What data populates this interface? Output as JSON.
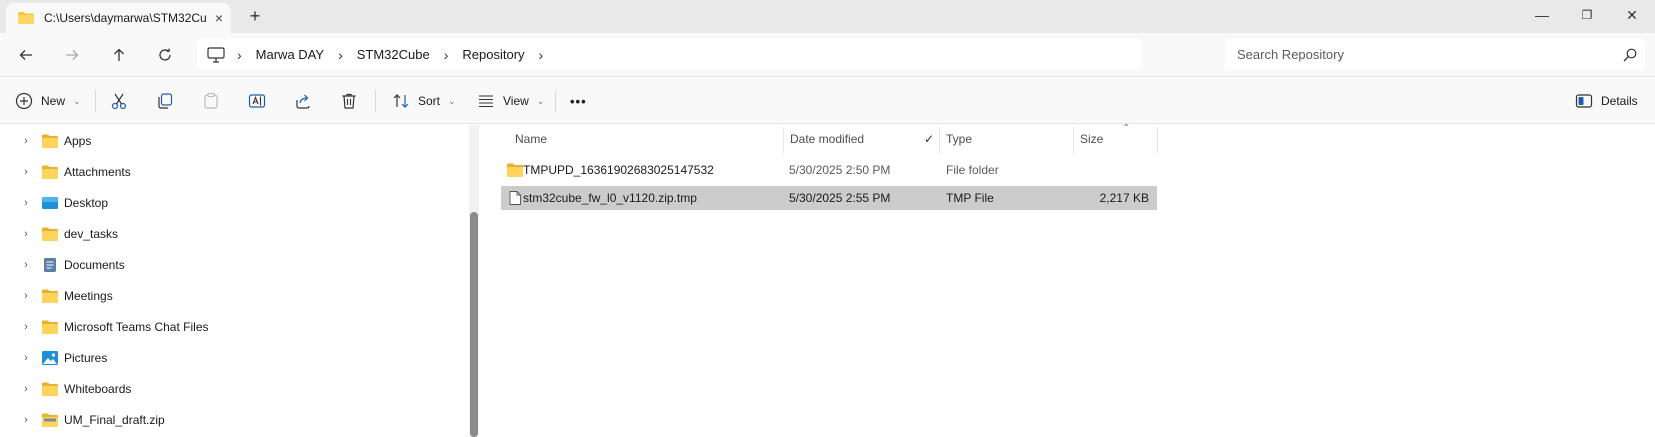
{
  "tab": {
    "title": "C:\\Users\\daymarwa\\STM32Cu",
    "close": "×",
    "new": "+"
  },
  "window": {
    "minimize": "—",
    "maximize": "❐",
    "close": "✕"
  },
  "breadcrumbs": [
    "Marwa DAY",
    "STM32Cube",
    "Repository"
  ],
  "search": {
    "placeholder": "Search Repository"
  },
  "toolbar": {
    "new_label": "New",
    "sort_label": "Sort",
    "view_label": "View",
    "more_label": "•••",
    "details_label": "Details"
  },
  "nav": {
    "items": [
      {
        "label": "Apps",
        "icon": "folder-icon"
      },
      {
        "label": "Attachments",
        "icon": "folder-icon"
      },
      {
        "label": "Desktop",
        "icon": "desktop-icon"
      },
      {
        "label": "dev_tasks",
        "icon": "folder-icon"
      },
      {
        "label": "Documents",
        "icon": "documents-icon"
      },
      {
        "label": "Meetings",
        "icon": "folder-icon"
      },
      {
        "label": "Microsoft Teams Chat Files",
        "icon": "folder-icon"
      },
      {
        "label": "Pictures",
        "icon": "pictures-icon"
      },
      {
        "label": "Whiteboards",
        "icon": "folder-icon"
      },
      {
        "label": "UM_Final_draft.zip",
        "icon": "zip-folder-icon"
      }
    ]
  },
  "columns": {
    "name": "Name",
    "date": "Date modified",
    "type": "Type",
    "size": "Size"
  },
  "files": [
    {
      "name": "TMPUPD_16361902683025147532",
      "date": "5/30/2025 2:50 PM",
      "type": "File folder",
      "size": "",
      "icon": "folder-icon",
      "selected": false
    },
    {
      "name": "stm32cube_fw_l0_v1120.zip.tmp",
      "date": "5/30/2025 2:55 PM",
      "type": "TMP File",
      "size": "2,217 KB",
      "icon": "file-icon",
      "selected": true
    }
  ],
  "colors": {
    "folder": "#f5c542",
    "accent": "#0067c0",
    "selected_row": "#cccccc"
  }
}
